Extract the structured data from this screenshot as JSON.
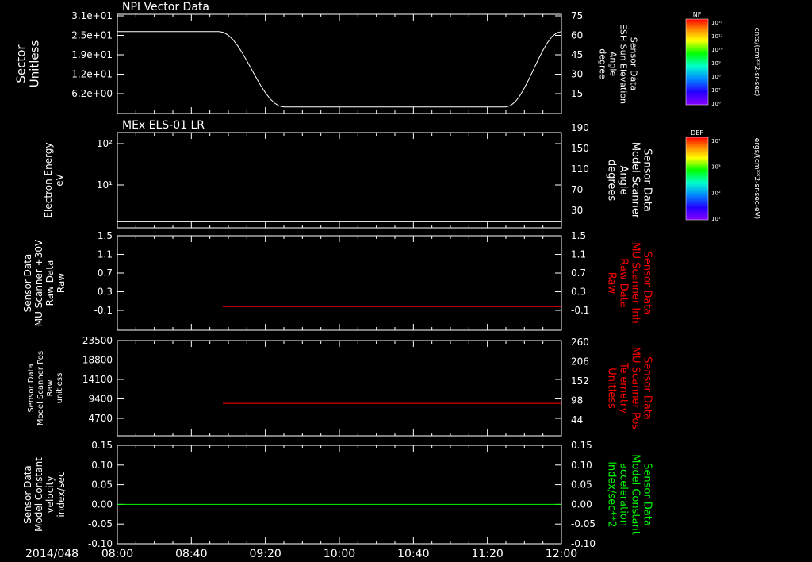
{
  "figure": {
    "date_label": "2014/048",
    "time_ticks": [
      "08:00",
      "08:40",
      "09:20",
      "10:00",
      "10:40",
      "11:20",
      "12:00"
    ],
    "time_range_minutes": [
      480,
      720
    ]
  },
  "colorbars": [
    {
      "title": "NF",
      "top_tick": "10¹²",
      "bottom_tick": "10⁶",
      "ticks": [
        "10¹²",
        "10¹¹",
        "10¹⁰",
        "10⁹",
        "10⁸",
        "10⁷",
        "10⁶"
      ],
      "unit": "cnts/(cm**2-sr-sec)"
    },
    {
      "title": "DEF",
      "top_tick": "10⁴",
      "bottom_tick": "10¹",
      "ticks": [
        "10⁴",
        "10³",
        "10²",
        "10¹"
      ],
      "unit": "ergs/(cm**2-sr-sec-eV)"
    }
  ],
  "chart_data": [
    {
      "type": "heatmap",
      "title": "NPI Vector Data",
      "ylabel_lines": [
        "Sector",
        "Unitless"
      ],
      "yticks": [
        "3.1e+01",
        "2.5e+01",
        "1.9e+01",
        "1.2e+01",
        "6.2e+00"
      ],
      "ylim": [
        0,
        31
      ],
      "spectrogram_x_range": [
        1118,
        1200
      ],
      "overlay": {
        "name_lines": [
          "Sensor Data",
          "ESH Sun Elevation",
          "Angle",
          "degree"
        ],
        "right_ticks": [
          "75",
          "60",
          "45",
          "30",
          "15"
        ],
        "right_ylim": [
          0,
          75
        ],
        "color": "#ffffff",
        "x": [
          480,
          535,
          570,
          690,
          725,
          745,
          720
        ],
        "y": [
          62,
          62,
          5,
          5,
          30,
          62,
          62
        ]
      }
    },
    {
      "type": "heatmap",
      "title": "MEx ELS-01 LR",
      "ylabel_lines": [
        "Electron Energy",
        "eV"
      ],
      "yticks": [
        "10²",
        "10¹"
      ],
      "ylog": true,
      "spectrogram_x_range": [
        1058,
        1133
      ],
      "gap_x_range": [
        1090,
        1099
      ],
      "overlay": {
        "name_lines": [
          "Sensor Data",
          "Model Scanner",
          "Angle",
          "degrees"
        ],
        "right_ticks": [
          "190",
          "150",
          "110",
          "70",
          "30"
        ],
        "right_ylim": [
          0,
          190
        ],
        "color": "#ffffff",
        "x": [
          480,
          720
        ],
        "y": [
          12,
          12
        ]
      }
    },
    {
      "type": "line",
      "ylabel_lines": [
        "Sensor Data",
        "MU Scanner +30V",
        "Raw Data",
        "Raw"
      ],
      "yticks": [
        "1.5",
        "1.1",
        "0.7",
        "0.3",
        "-0.1"
      ],
      "ylim": [
        -0.5,
        1.5
      ],
      "series": [
        {
          "name_lines": [
            "Sensor Data",
            "MU Scanner Inh",
            "Raw Data",
            "Raw"
          ],
          "color": "#ff0000",
          "x": [
            537,
            720
          ],
          "y": [
            0.0,
            0.0
          ]
        }
      ],
      "right_ticks": [
        "1.5",
        "1.1",
        "0.7",
        "0.3",
        "-0.1"
      ]
    },
    {
      "type": "line",
      "ylabel_lines": [
        "Sensor Data",
        "Model Scanner Pos",
        "Raw",
        "unitless"
      ],
      "yticks": [
        "23500",
        "18800",
        "14100",
        "9400",
        "4700"
      ],
      "ylim": [
        0,
        23500
      ],
      "series": [
        {
          "name_lines": [
            "Sensor Data",
            "MU Scanner Pos",
            "Telemetry",
            "Unitless"
          ],
          "color": "#ff0000",
          "x": [
            537,
            720
          ],
          "y": [
            8000,
            8000
          ]
        }
      ],
      "right_ticks": [
        "260",
        "206",
        "152",
        "98",
        "44"
      ]
    },
    {
      "type": "line",
      "ylabel_lines": [
        "Sensor Data",
        "Model Constant",
        "velocity",
        "index/sec"
      ],
      "yticks": [
        "0.15",
        "0.10",
        "0.05",
        "0.00",
        "-0.05",
        "-0.10"
      ],
      "ylim": [
        -0.1,
        0.15
      ],
      "series": [
        {
          "name_lines": [
            "Sensor Data",
            "Model Constant",
            "acceleration",
            "index/sec**2"
          ],
          "color": "#00ff00",
          "x": [
            480,
            720
          ],
          "y": [
            0.0,
            0.0
          ]
        }
      ],
      "right_ticks": [
        "0.15",
        "0.10",
        "0.05",
        "0.00",
        "-0.05",
        "-0.10"
      ]
    }
  ]
}
